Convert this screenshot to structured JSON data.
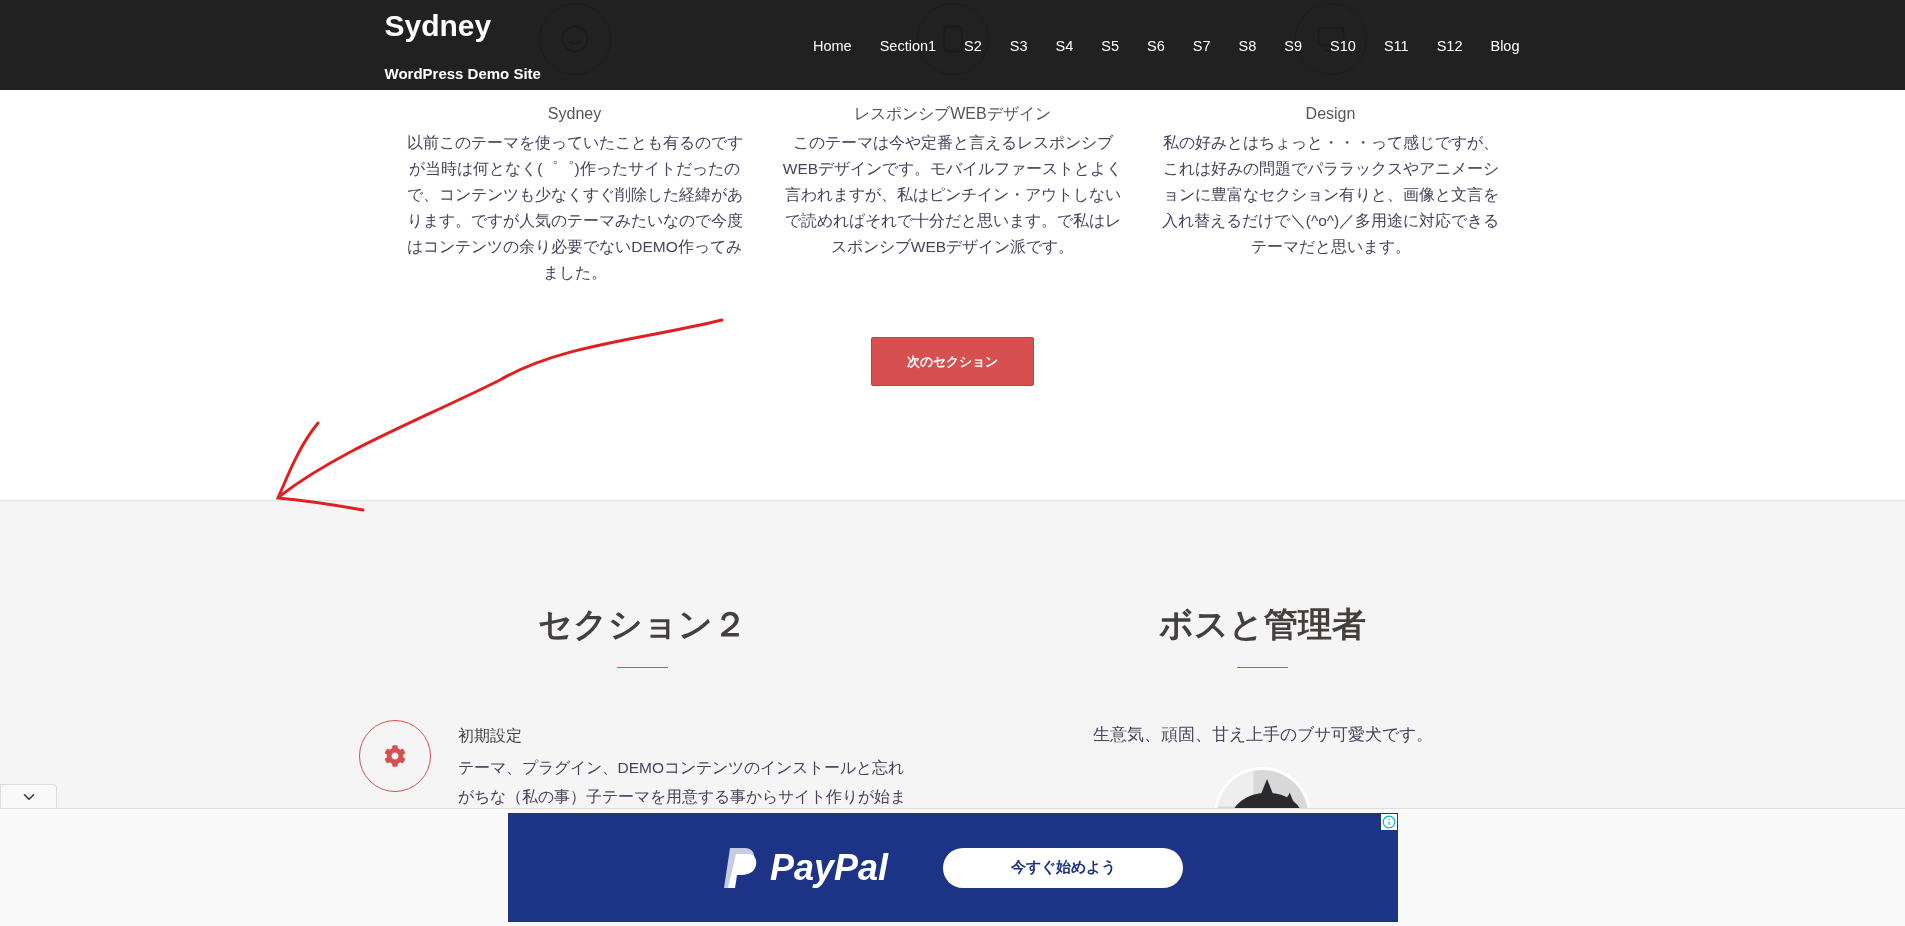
{
  "header": {
    "site_title": "Sydney",
    "tagline": "WordPress Demo Site",
    "nav": [
      "Home",
      "Section1",
      "S2",
      "S3",
      "S4",
      "S5",
      "S6",
      "S7",
      "S8",
      "S9",
      "S10",
      "S11",
      "S12",
      "Blog"
    ]
  },
  "features": [
    {
      "title": "Sydney",
      "text": "以前このテーマを使っていたことも有るのですが当時は何となく(゜゜)作ったサイトだったので、コンテンツも少なくすぐ削除した経緯があります。ですが人気のテーマみたいなので今度はコンテンツの余り必要でないDEMO作ってみました。"
    },
    {
      "title": "レスポンシブWEBデザイン",
      "text": "このテーマは今や定番と言えるレスポンシブWEBデザインです。モバイルファーストとよく言われますが、私はピンチイン・アウトしないで読めればそれで十分だと思います。で私はレスポンシブWEBデザイン派です。"
    },
    {
      "title": "Design",
      "text": "私の好みとはちょっと・・・って感じですが、これは好みの問題でパララックスやアニメーションに豊富なセクション有りと、画像と文言を入れ替えるだけで＼(^o^)／多用途に対応できるテーマだと思います。"
    }
  ],
  "next_button": "次のセクション",
  "section2": {
    "heading": "セクション２",
    "items": [
      {
        "title": "初期設定",
        "lines": [
          "テーマ、プラグイン、DEMOコンテンツのインストールと忘れ",
          "がちな（私の事）子テーマを用意する事からサイト作りが始ま"
        ]
      }
    ]
  },
  "boss": {
    "heading": "ボスと管理者",
    "text": "生意気、頑固、甘え上手のブサ可愛犬です。"
  },
  "ad": {
    "logo_text": "PayPal",
    "button": "今すぐ始めよう"
  }
}
